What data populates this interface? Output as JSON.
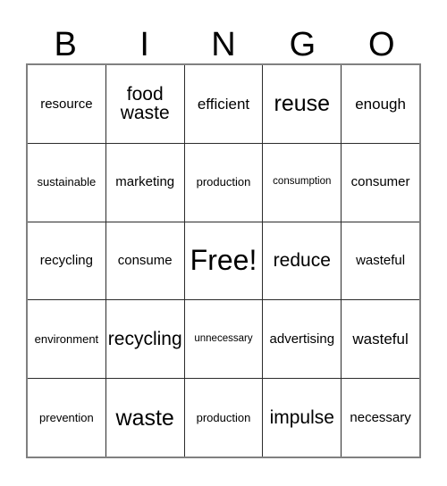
{
  "card": {
    "header_letters": [
      "B",
      "I",
      "N",
      "G",
      "O"
    ],
    "rows": [
      [
        {
          "text": "resource",
          "size": "md"
        },
        {
          "text": "food\nwaste",
          "size": "xl"
        },
        {
          "text": "efficient",
          "size": "lg"
        },
        {
          "text": "reuse",
          "size": "xxl"
        },
        {
          "text": "enough",
          "size": "lg"
        }
      ],
      [
        {
          "text": "sustainable",
          "size": "sm"
        },
        {
          "text": "marketing",
          "size": "md"
        },
        {
          "text": "production",
          "size": "sm"
        },
        {
          "text": "consumption",
          "size": "xs"
        },
        {
          "text": "consumer",
          "size": "md"
        }
      ],
      [
        {
          "text": "recycling",
          "size": "md"
        },
        {
          "text": "consume",
          "size": "md"
        },
        {
          "text": "Free!",
          "size": "free"
        },
        {
          "text": "reduce",
          "size": "xl"
        },
        {
          "text": "wasteful",
          "size": "md"
        }
      ],
      [
        {
          "text": "environment",
          "size": "sm"
        },
        {
          "text": "recycling",
          "size": "xl"
        },
        {
          "text": "unnecessary",
          "size": "xs"
        },
        {
          "text": "advertising",
          "size": "md"
        },
        {
          "text": "wasteful",
          "size": "lg"
        }
      ],
      [
        {
          "text": "prevention",
          "size": "sm"
        },
        {
          "text": "waste",
          "size": "xxl"
        },
        {
          "text": "production",
          "size": "sm"
        },
        {
          "text": "impulse",
          "size": "xl"
        },
        {
          "text": "necessary",
          "size": "md"
        }
      ]
    ]
  },
  "colors": {
    "text": "#000000",
    "background": "#ffffff",
    "outer_border": "#808080",
    "inner_border": "#2b2b2b"
  }
}
